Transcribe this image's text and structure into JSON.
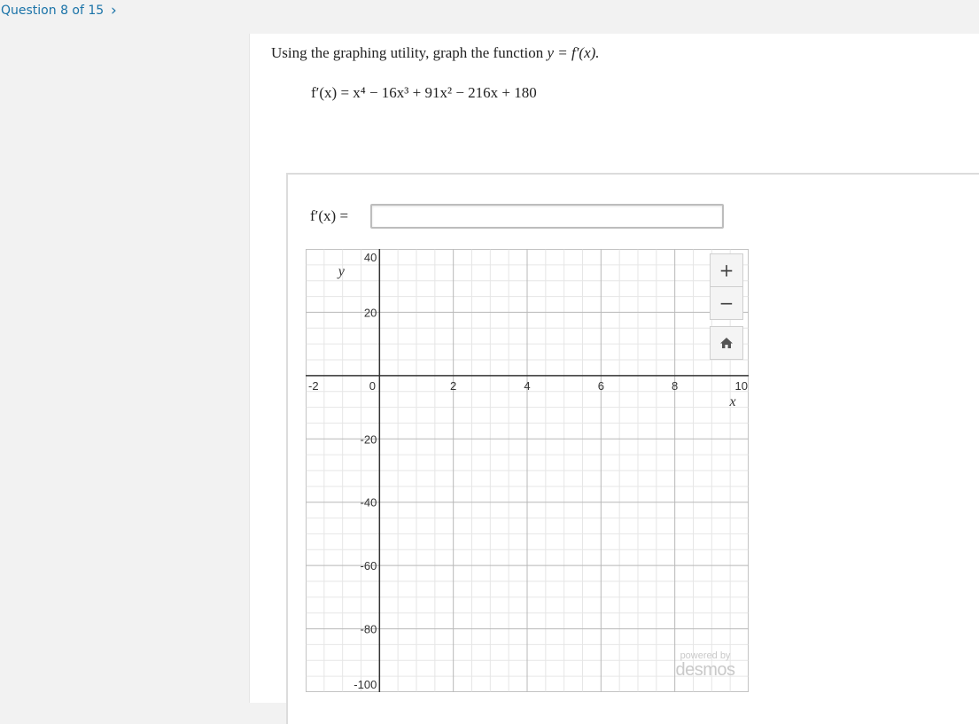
{
  "nav": {
    "question_counter": "Question 8 of 15",
    "next_glyph": "›"
  },
  "question": {
    "prompt_text": "Using the graphing utility, graph the function ",
    "prompt_math": "y = f′(x).",
    "equation": "f′(x) = x⁴ − 16x³ + 91x² − 216x + 180"
  },
  "answer": {
    "label": "f′(x) =",
    "value": "",
    "placeholder": ""
  },
  "graph": {
    "xlabel": "x",
    "ylabel": "y",
    "x_ticks": [
      "-2",
      "0",
      "2",
      "4",
      "6",
      "8",
      "10"
    ],
    "y_ticks": [
      "40",
      "20",
      "-20",
      "-40",
      "-60",
      "-80",
      "-100"
    ],
    "xlim": [
      -2,
      10
    ],
    "ylim": [
      -100,
      40
    ],
    "zoom_in_label": "+",
    "zoom_out_label": "−",
    "home_icon": "home-icon",
    "powered_by": "powered by",
    "brand": "desmos"
  }
}
